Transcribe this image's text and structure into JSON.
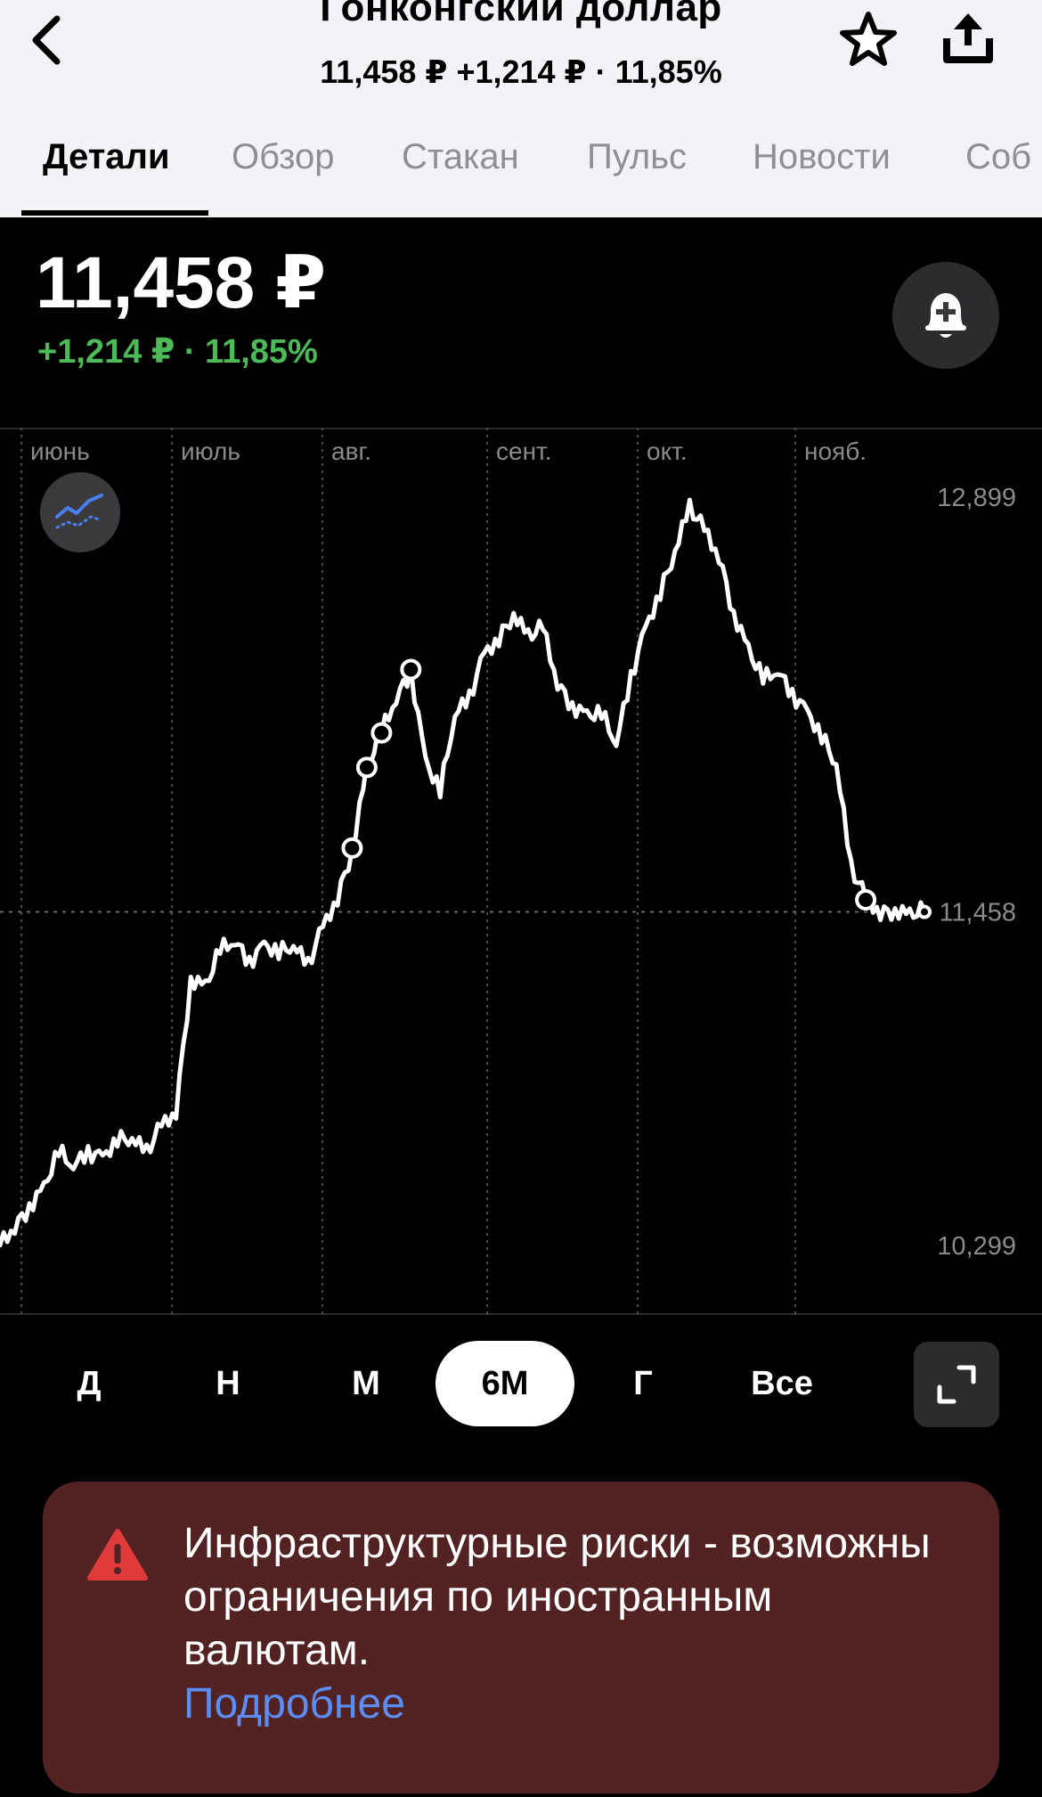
{
  "header": {
    "title": "Гонконгский доллар",
    "subtitle": "11,458 ₽  +1,214 ₽ · 11,85%",
    "icons": {
      "back": "chevron-left-icon",
      "star": "star-icon",
      "share": "share-icon"
    }
  },
  "tabs": [
    {
      "label": "Детали",
      "active": true
    },
    {
      "label": "Обзор"
    },
    {
      "label": "Стакан"
    },
    {
      "label": "Пульс"
    },
    {
      "label": "Новости"
    },
    {
      "label": "Соб"
    }
  ],
  "quote": {
    "price": "11,458 ₽",
    "change": "+1,214 ₽ · 11,85%",
    "change_color": "#4cba57"
  },
  "alert_button_icon": "bell-plus-icon",
  "indicator_button_icon": "indicator-chart-icon",
  "chart_data": {
    "type": "line",
    "months": [
      "июнь",
      "июль",
      "авг.",
      "сент.",
      "окт.",
      "нояб."
    ],
    "y_ticks": [
      "12,899",
      "11,458",
      "10,299"
    ],
    "current_value": 11.458,
    "ylim": [
      10.299,
      12.899
    ],
    "grid": true,
    "series": [
      {
        "values": [
          10.3,
          10.36,
          10.44,
          10.5,
          10.62,
          10.58,
          10.63,
          10.6,
          10.66,
          10.68,
          10.63,
          10.71,
          10.76,
          11.23,
          11.2,
          11.32,
          11.36,
          11.29,
          11.34,
          11.31,
          11.35,
          11.28,
          11.4,
          11.5,
          11.68,
          11.96,
          12.08,
          12.2,
          12.3,
          11.98,
          11.87,
          12.15,
          12.21,
          12.35,
          12.4,
          12.5,
          12.42,
          12.44,
          12.25,
          12.18,
          12.14,
          12.14,
          12.05,
          12.28,
          12.44,
          12.56,
          12.72,
          12.87,
          12.78,
          12.69,
          12.5,
          12.37,
          12.26,
          12.3,
          12.22,
          12.15,
          12.06,
          11.98,
          11.62,
          11.5,
          11.45,
          11.47,
          11.45,
          11.458
        ]
      }
    ],
    "markers": [
      "A",
      "A",
      "D",
      "D",
      "D"
    ]
  },
  "periods": [
    {
      "label": "Д"
    },
    {
      "label": "Н"
    },
    {
      "label": "М"
    },
    {
      "label": "6М",
      "active": true
    },
    {
      "label": "Г"
    },
    {
      "label": "Все"
    }
  ],
  "expand_icon": "expand-icon",
  "banner": {
    "icon": "warning-icon",
    "text": "Инфраструктурные риски - возможны ограничения по иностранным валютам.",
    "link": "Подробнее"
  }
}
